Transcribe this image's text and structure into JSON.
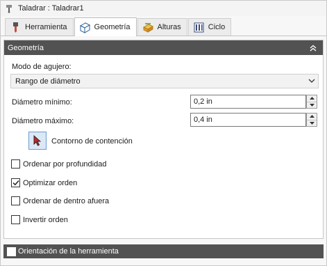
{
  "titlebar": {
    "title": "Taladrar : Taladrar1",
    "icon": "drill-icon"
  },
  "tabs": [
    {
      "label": "Herramienta",
      "icon": "tool-icon",
      "active": false
    },
    {
      "label": "Geometría",
      "icon": "geometry-cube-icon",
      "active": true
    },
    {
      "label": "Alturas",
      "icon": "heights-icon",
      "active": false
    },
    {
      "label": "Ciclo",
      "icon": "cycle-icon",
      "active": false
    }
  ],
  "geometry_panel": {
    "title": "Geometría",
    "hole_mode_label": "Modo de agujero:",
    "hole_mode_value": "Rango de diámetro",
    "min_diameter_label": "Diámetro mínimo:",
    "min_diameter_value": "0,2 in",
    "max_diameter_label": "Diámetro máximo:",
    "max_diameter_value": "0,4 in",
    "containment_label": "Contorno de contención",
    "checkboxes": [
      {
        "label": "Ordenar por profundidad",
        "checked": false
      },
      {
        "label": "Optimizar orden",
        "checked": true
      },
      {
        "label": "Ordenar de dentro afuera",
        "checked": false
      },
      {
        "label": "Invertir orden",
        "checked": false
      }
    ]
  },
  "tool_orientation": {
    "label": "Orientación de la herramienta",
    "checked": false
  },
  "colors": {
    "header_bg": "#525252",
    "accent_blue": "#6b9ccf"
  }
}
